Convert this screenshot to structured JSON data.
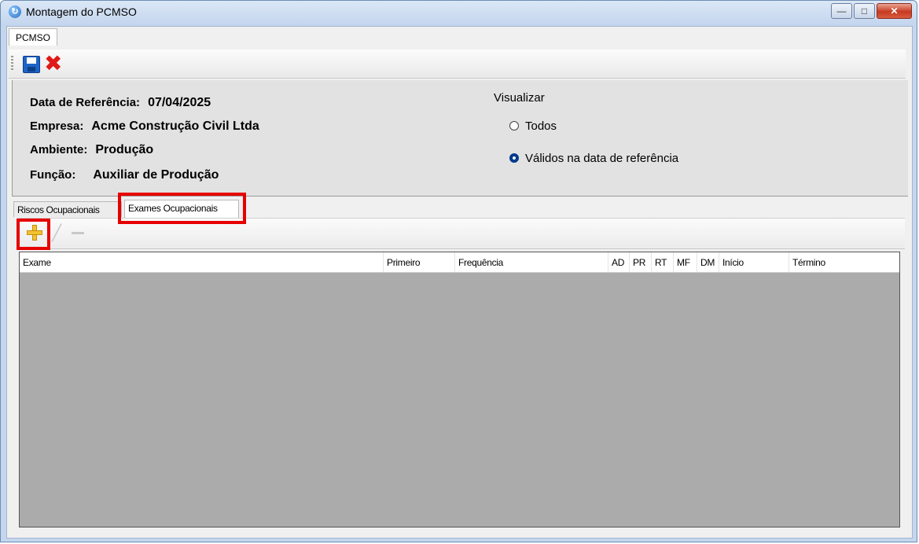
{
  "window": {
    "title": "Montagem do PCMSO",
    "minimize_label": "—",
    "maximize_label": "□",
    "close_label": "✕"
  },
  "outer_tab": {
    "label": "PCMSO"
  },
  "toolbar": {
    "save_icon": "save-icon",
    "close_icon": "close-icon",
    "close_glyph": "✖"
  },
  "info": {
    "data_ref_label": "Data de Referência:",
    "data_ref_value": "07/04/2025",
    "empresa_label": "Empresa:",
    "empresa_value": "Acme Construção Civil Ltda",
    "ambiente_label": "Ambiente:",
    "ambiente_value": "Produção",
    "funcao_label": "Função:",
    "funcao_value": "Auxiliar de Produção"
  },
  "visualizar": {
    "label": "Visualizar",
    "options": [
      {
        "label": "Todos",
        "selected": false
      },
      {
        "label": "Válidos na data de referência",
        "selected": true
      }
    ]
  },
  "tabs": [
    {
      "label": "Riscos Ocupacionais",
      "active": false
    },
    {
      "label": "Exames Ocupacionais",
      "active": true
    }
  ],
  "subtoolbar": {
    "add_icon": "plus-icon",
    "edit_icon": "pencil-icon",
    "remove_icon": "minus-icon",
    "edit_glyph": "╱"
  },
  "grid": {
    "columns": [
      "Exame",
      "Primeiro",
      "Frequência",
      "AD",
      "PR",
      "RT",
      "MF",
      "DM",
      "Início",
      "Término"
    ],
    "rows": []
  },
  "colors": {
    "highlight": "#e60000",
    "grid_bg": "#ababab",
    "panel_bg": "#e2e2e2"
  }
}
